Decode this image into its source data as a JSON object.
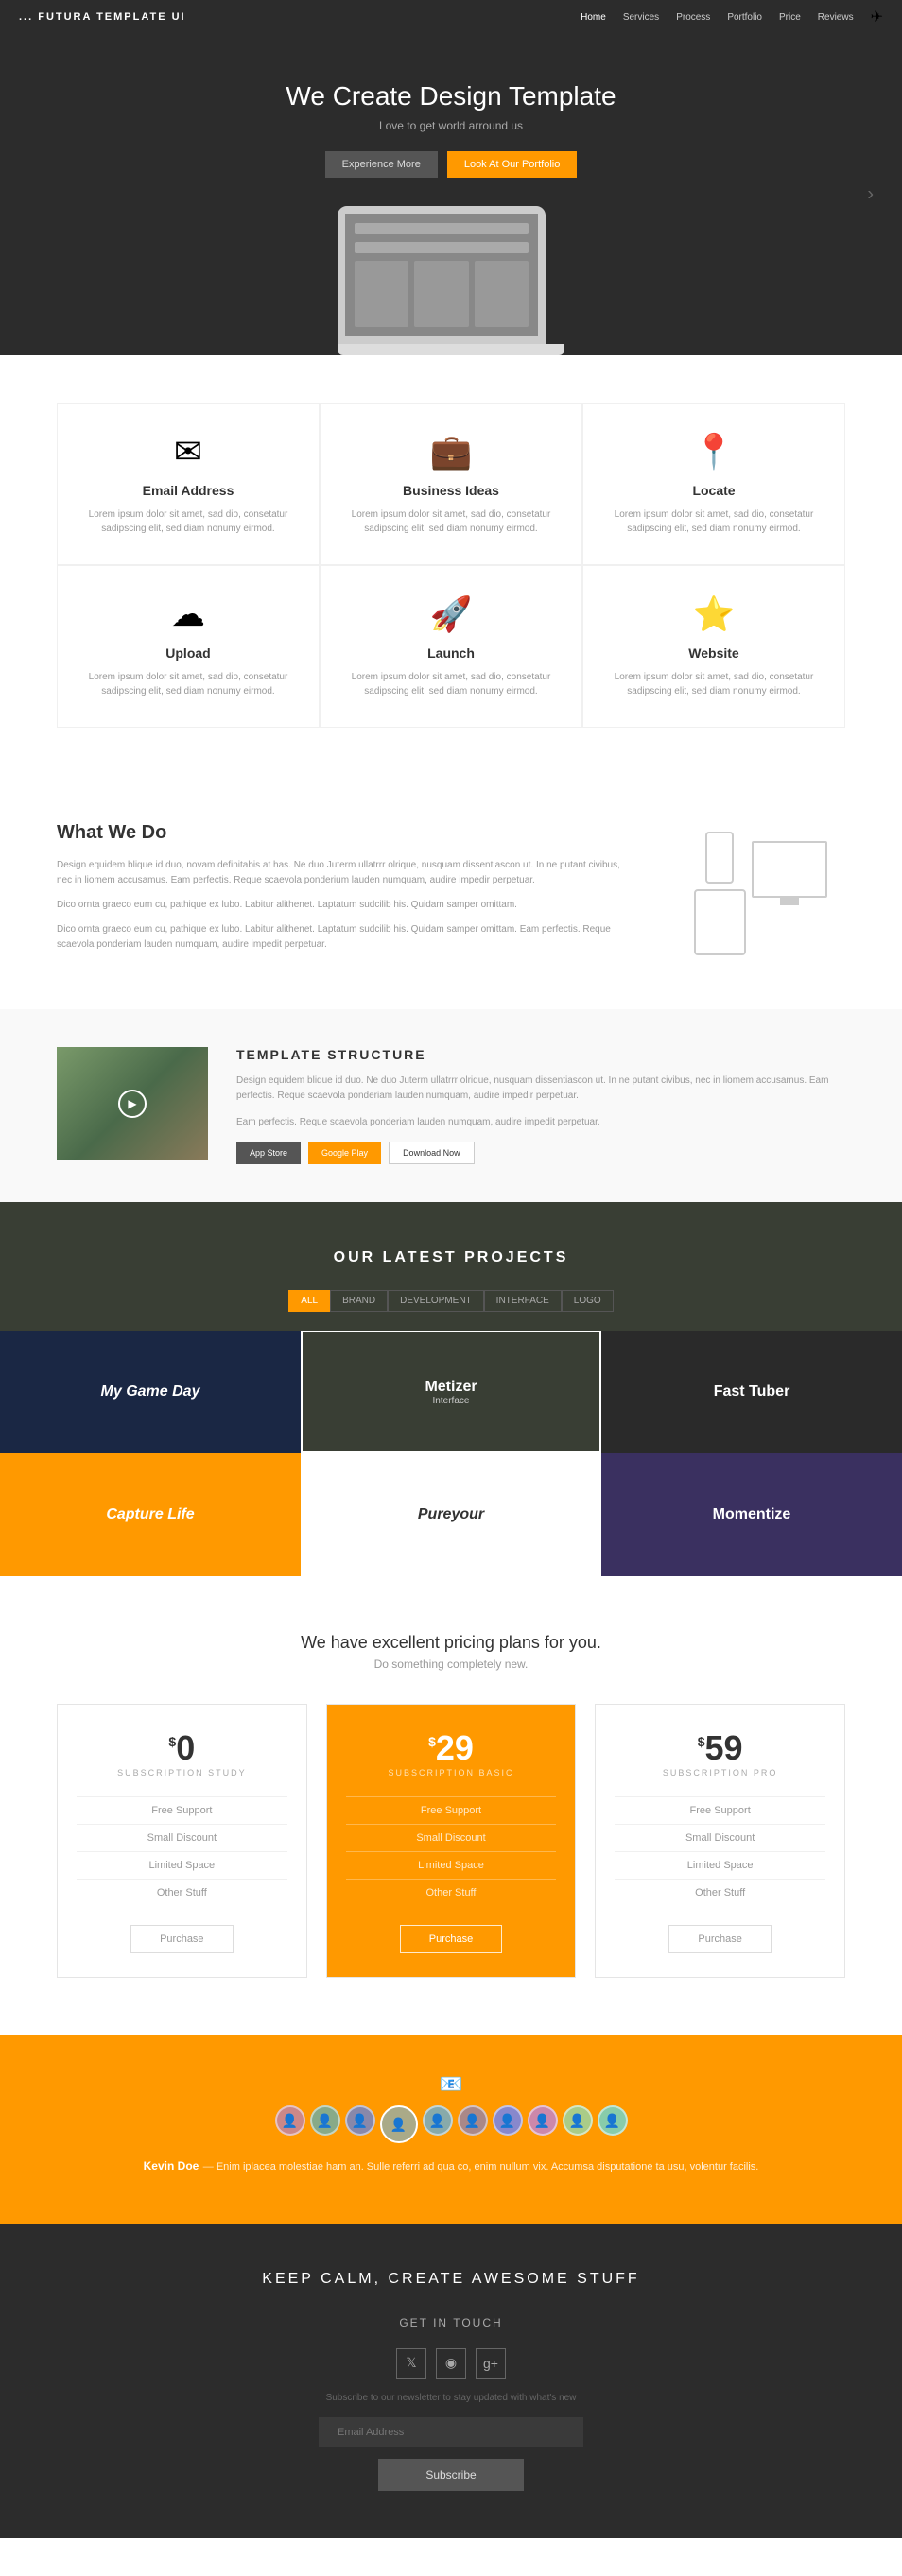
{
  "navbar": {
    "brand": "... FUTURA TEMPLATE UI",
    "links": [
      "Home",
      "Services",
      "Process",
      "Portfolio",
      "Price",
      "Reviews"
    ]
  },
  "hero": {
    "title": "We Create Design Template",
    "subtitle": "Love to get world arround us",
    "btn1": "Experience More",
    "btn2": "Look At Our Portfolio"
  },
  "features": [
    {
      "icon": "✉",
      "title": "Email Address",
      "desc": "Lorem ipsum dolor sit amet, sad dio, consetatur sadipscing elit, sed diam nonumy eirmod."
    },
    {
      "icon": "💼",
      "title": "Business Ideas",
      "desc": "Lorem ipsum dolor sit amet, sad dio, consetatur sadipscing elit, sed diam nonumy eirmod."
    },
    {
      "icon": "📍",
      "title": "Locate",
      "desc": "Lorem ipsum dolor sit amet, sad dio, consetatur sadipscing elit, sed diam nonumy eirmod."
    },
    {
      "icon": "☁",
      "title": "Upload",
      "desc": "Lorem ipsum dolor sit amet, sad dio, consetatur sadipscing elit, sed diam nonumy eirmod."
    },
    {
      "icon": "🚀",
      "title": "Launch",
      "desc": "Lorem ipsum dolor sit amet, sad dio, consetatur sadipscing elit, sed diam nonumy eirmod."
    },
    {
      "icon": "⭐",
      "title": "Website",
      "desc": "Lorem ipsum dolor sit amet, sad dio, consetatur sadipscing elit, sed diam nonumy eirmod."
    }
  ],
  "whatWeDo": {
    "title": "What We Do",
    "paragraphs": [
      "Design equidem blique id duo, novam definitabis at has. Ne duo Juterm ullatrrr olrique, nusquam dissentiascon ut. In ne putant civibus, nec in liomem accusamus. Eam perfectis. Reque scaevola ponderium lauden numquam, audire impedir perpetuar.",
      "Dico ornta graeco eum cu, pathique ex lubo. Labitur alithenet. Laptatum sudcilib his. Quidam samper omittam.",
      "Dico ornta graeco eum cu, pathique ex lubo. Labitur alithenet. Laptatum sudcilib his. Quidam samper omittam. Eam perfectis. Reque scaevola ponderiam lauden numquam, audire impedit perpetuar."
    ]
  },
  "templateStructure": {
    "title": "TEMPLATE STRUCTURE",
    "paragraphs": [
      "Design equidem blique id duo. Ne duo Juterm ullatrrr olrique, nusquam dissentiascon ut. In ne putant civibus, nec in liomem accusamus. Eam perfectis. Reque scaevola ponderiam lauden numquam, audire impedir perpetuar.",
      "Eam perfectis. Reque scaevola ponderiam lauden numquam, audire impedit perpetuar."
    ],
    "btn_appstore": "App Store",
    "btn_google": "Google Play",
    "btn_download": "Download Now"
  },
  "projects": {
    "heading": "OUR LATEST PROJECTS",
    "filters": [
      "ALL",
      "BRAND",
      "DEVELOPMENT",
      "INTERFACE",
      "LOGO"
    ],
    "activeFilter": "ALL",
    "items": [
      {
        "title": "My Game Day",
        "sub": "",
        "style": "dark-blue",
        "italic": true
      },
      {
        "title": "Metizer",
        "sub": "Interface",
        "style": "outline"
      },
      {
        "title": "Fast Tuber",
        "sub": "",
        "style": "dark"
      },
      {
        "title": "Capture Life",
        "sub": "",
        "style": "orange",
        "italic": true
      },
      {
        "title": "Pureyour",
        "sub": "",
        "style": "white-txt",
        "italic": true
      },
      {
        "title": "Momentize",
        "sub": "",
        "style": "purple"
      }
    ]
  },
  "pricing": {
    "title": "We have excellent pricing plans for you.",
    "subtitle": "Do something completely new.",
    "plans": [
      {
        "price": "0",
        "label": "SUBSCRIPTION STUDY",
        "features": [
          "Free Support",
          "Small Discount",
          "Limited Space",
          "Other Stuff"
        ],
        "btn": "Purchase",
        "featured": false
      },
      {
        "price": "29",
        "label": "SUBSCRIPTION BASIC",
        "features": [
          "Free Support",
          "Small Discount",
          "Limited Space",
          "Other Stuff"
        ],
        "btn": "Purchase",
        "featured": true
      },
      {
        "price": "59",
        "label": "SUBSCRIPTION PRO",
        "features": [
          "Free Support",
          "Small Discount",
          "Limited Space",
          "Other Stuff"
        ],
        "btn": "Purchase",
        "featured": false
      }
    ]
  },
  "testimonial": {
    "author": "Kevin Doe",
    "em_dash": "—",
    "text": "Enim iplacea molestiae ham an. Sulle referri ad qua co, enim nullum vix. Accumsa disputatione ta usu, volentur facilis."
  },
  "footer": {
    "tagline": "KEEP CALM, CREATE AWESOME STUFF",
    "get_in_touch": "GET IN TOUCH",
    "sub_text": "Subscribe to our newsletter to stay updated with what's new",
    "email_placeholder": "Email Address",
    "subscribe_btn": "Subscribe"
  }
}
